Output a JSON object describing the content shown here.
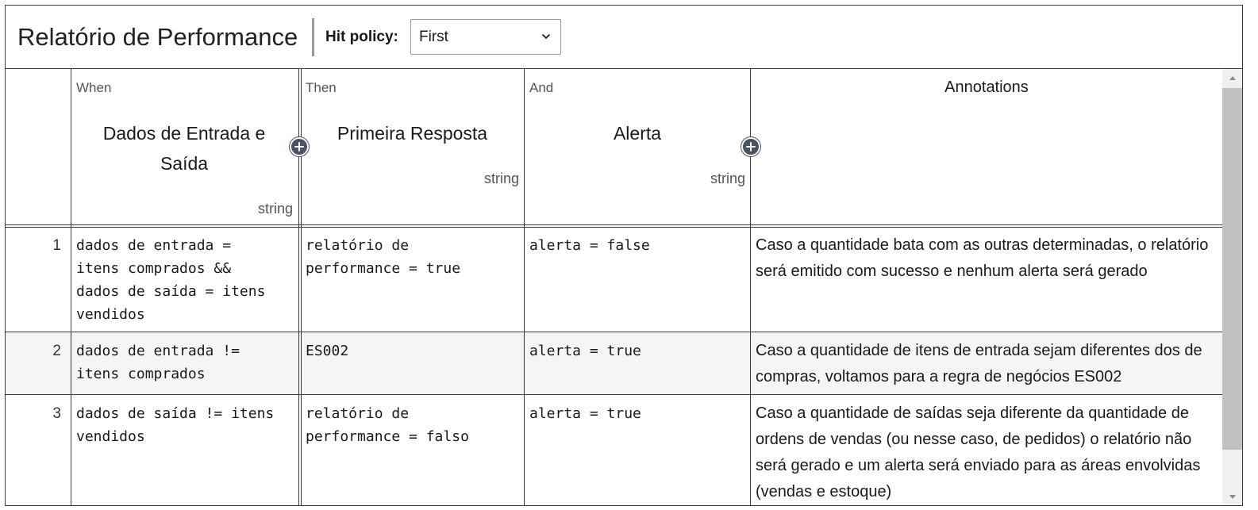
{
  "header": {
    "title": "Relatório de Performance",
    "hit_policy_label": "Hit policy:",
    "hit_policy_value": "First"
  },
  "columns": {
    "input": {
      "kind": "When",
      "name": "Dados de Entrada e Saída",
      "type": "string"
    },
    "output1": {
      "kind": "Then",
      "name": "Primeira Resposta",
      "type": "string"
    },
    "output2": {
      "kind": "And",
      "name": "Alerta",
      "type": "string"
    },
    "annotations": {
      "name": "Annotations"
    }
  },
  "rows": [
    {
      "num": "1",
      "input": "dados de entrada =\nitens comprados &&\ndados de saída = itens\nvendidos",
      "output1": "relatório de\nperformance = true",
      "output2": "alerta = false",
      "annotation": "Caso a quantidade bata com as outras determinadas, o relatório será emitido com sucesso e nenhum alerta será gerado"
    },
    {
      "num": "2",
      "input": "dados de entrada !=\nitens comprados",
      "output1": "ES002",
      "output2": "alerta = true",
      "annotation": "Caso a quantidade de itens de entrada sejam diferentes dos de compras, voltamos para a regra de negócios ES002"
    },
    {
      "num": "3",
      "input": "dados de saída != itens\nvendidos",
      "output1": "relatório de\nperformance = falso",
      "output2": "alerta = true",
      "annotation": "Caso a quantidade de saídas seja diferente da quantidade de ordens de vendas (ou nesse caso, de pedidos) o relatório não será gerado e um alerta será enviado para as áreas envolvidas (vendas e estoque)"
    }
  ],
  "icons": {
    "add_column": "plus-circle-icon",
    "dropdown": "chevron-down-icon",
    "scroll_up": "triangle-up-icon",
    "scroll_down": "triangle-down-icon"
  },
  "colors": {
    "border": "#3a3a3a",
    "add_button": "#4a5160",
    "alt_row": "#f5f5f5"
  }
}
